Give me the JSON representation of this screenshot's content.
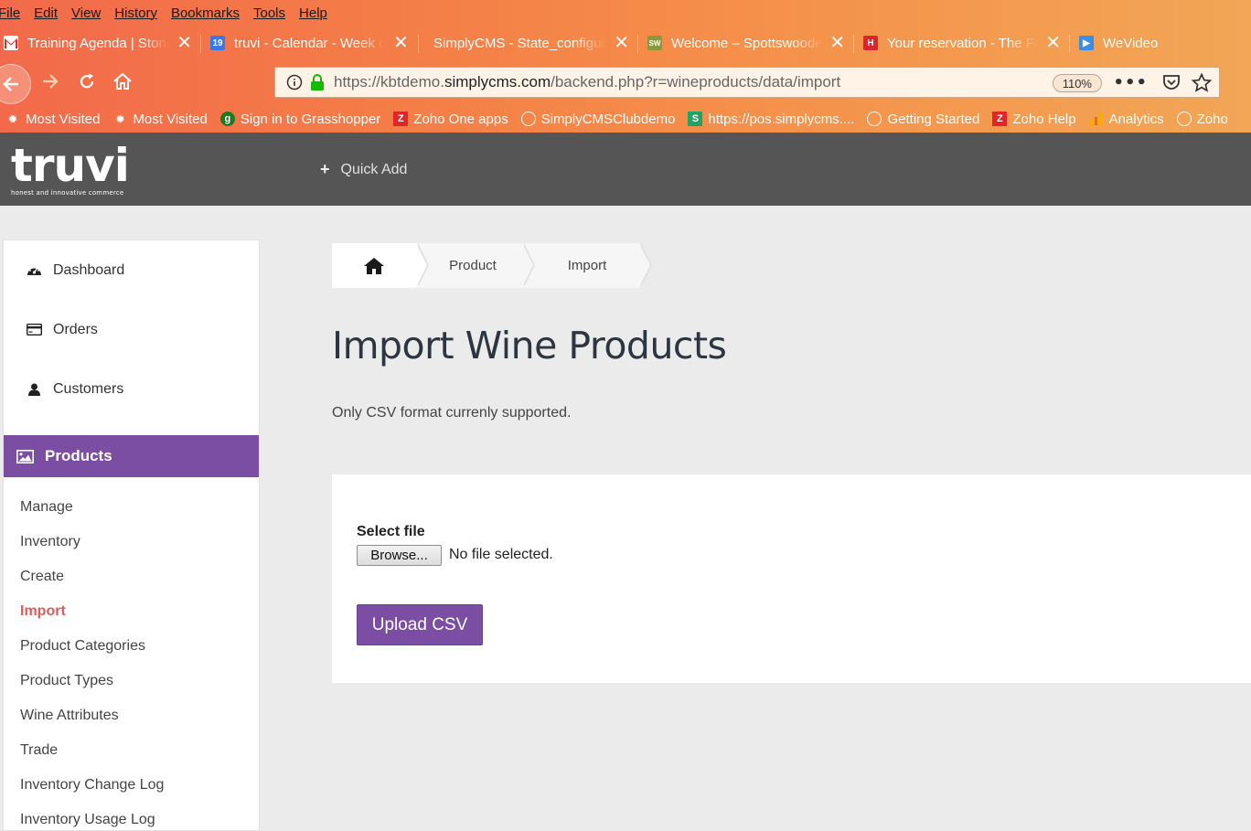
{
  "browser": {
    "menu": [
      "File",
      "Edit",
      "View",
      "History",
      "Bookmarks",
      "Tools",
      "Help"
    ],
    "tabs": [
      {
        "title": "Training Agenda | Stone",
        "icon": "gmail-icon"
      },
      {
        "title": "truvi - Calendar - Week o",
        "icon": "calendar-icon"
      },
      {
        "title": "SimplyCMS - State_configura",
        "icon": "none"
      },
      {
        "title": "Welcome – Spottswoode",
        "icon": "sw-icon"
      },
      {
        "title": "Your reservation - The Fa",
        "icon": "hotel-icon"
      },
      {
        "title": "WeVideo",
        "icon": "wevideo-icon"
      }
    ],
    "url_prefix": "https://kbtdemo.",
    "url_domain": "simplycms.com",
    "url_path": "/backend.php?r=wineproducts/data/import",
    "zoom": "110%",
    "bookmarks": [
      {
        "label": "Most Visited",
        "icon": "gear-icon"
      },
      {
        "label": "Most Visited",
        "icon": "gear-icon"
      },
      {
        "label": "Sign in to Grasshopper",
        "icon": "grasshopper-icon"
      },
      {
        "label": "Zoho One apps",
        "icon": "zoho-icon"
      },
      {
        "label": "SimplyCMSClubdemo",
        "icon": "globe-icon"
      },
      {
        "label": "https://pos.simplycms....",
        "icon": "s-icon"
      },
      {
        "label": "Getting Started",
        "icon": "globe-icon"
      },
      {
        "label": "Zoho Help",
        "icon": "zoho-icon"
      },
      {
        "label": "Analytics",
        "icon": "analytics-icon"
      },
      {
        "label": "Zoho",
        "icon": "globe-icon"
      }
    ],
    "colors": {
      "chrome_start": "#f26a4b",
      "chrome_end": "#f2a656"
    }
  },
  "app": {
    "logo_word": "truvi",
    "logo_tagline": "honest and innovative commerce",
    "quick_add": "Quick Add",
    "colors": {
      "header": "#555555",
      "accent": "#7b4ea3",
      "active_link": "#e05a5a"
    }
  },
  "sidebar": {
    "main_items": [
      {
        "label": "Dashboard",
        "icon": "dashboard-icon"
      },
      {
        "label": "Orders",
        "icon": "credit-card-icon"
      },
      {
        "label": "Customers",
        "icon": "user-icon"
      }
    ],
    "active_section": {
      "label": "Products",
      "icon": "image-icon"
    },
    "sub_items": [
      {
        "label": "Manage"
      },
      {
        "label": "Inventory"
      },
      {
        "label": "Create"
      },
      {
        "label": "Import",
        "current": true
      },
      {
        "label": "Product Categories"
      },
      {
        "label": "Product Types"
      },
      {
        "label": "Wine Attributes"
      },
      {
        "label": "Trade"
      },
      {
        "label": "Inventory Change Log"
      },
      {
        "label": "Inventory Usage Log"
      }
    ]
  },
  "breadcrumb": {
    "home_icon": "home-icon",
    "items": [
      "Product",
      "Import"
    ]
  },
  "main": {
    "title": "Import Wine Products",
    "note": "Only CSV format currenly supported.",
    "select_file_label": "Select file",
    "browse_label": "Browse...",
    "file_status": "No file selected.",
    "upload_label": "Upload CSV"
  }
}
